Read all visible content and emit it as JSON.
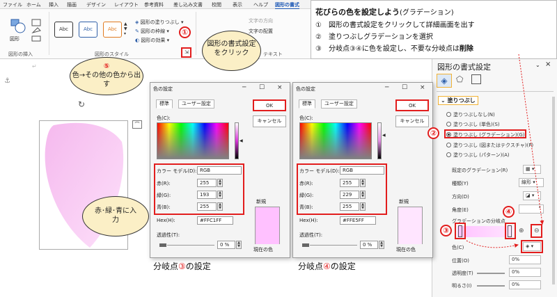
{
  "ribbon": {
    "tabs": [
      "ファイル",
      "ホーム",
      "挿入",
      "描画",
      "デザイン",
      "レイアウト",
      "参考資料",
      "差し込み文書",
      "校閲",
      "表示",
      "ヘルプ",
      "図形の書式"
    ],
    "insert_shapes": "図形の挿入",
    "shapes_btn": "図形",
    "style_sample": "Abc",
    "fill_btn": "図形の塗りつぶし",
    "outline_btn": "図形の枠線",
    "effect_btn": "図形の効果",
    "styles_group": "図形のスタイル",
    "text_dir": "文字の方向",
    "text_align": "文字の配置",
    "text_group": "テキスト",
    "launcher_icon": "⇲"
  },
  "note": {
    "title": "花びらの色を設定しよう",
    "title_sub": "(グラデーション)",
    "step1": "①　図形の書式設定をクリックして詳細画面を出す",
    "step2": "②　塗りつぶしグラデーションを選択",
    "step3_a": "③　分岐点③④に色を設定し、不要な分岐点は",
    "step3_b": "削除"
  },
  "pane": {
    "title": "図形の書式設定",
    "section": "塗りつぶし",
    "options": [
      "塗りつぶしなし(N)",
      "塗りつぶし (単色)(S)",
      "塗りつぶし (グラデーション)(G)",
      "塗りつぶし (図またはテクスチャ)(P)",
      "塗りつぶし (パターン)(A)"
    ],
    "preset": "既定のグラデーション(R)",
    "kind": "種類(Y)",
    "kind_value": "線形",
    "direction": "方向(D)",
    "angle": "角度(E)",
    "angle_value": "°",
    "stops": "グラデーションの分岐点",
    "color": "色(C)",
    "position": "位置(O)",
    "position_value": "0%",
    "transparency": "透明度(T)",
    "transparency_value": "0%",
    "brightness": "明るさ(I)",
    "brightness_value": "0%"
  },
  "dialog1": {
    "title": "色の設定",
    "tab_std": "標準",
    "tab_user": "ユーザー設定",
    "ok": "OK",
    "cancel": "キャンセル",
    "color_label": "色(C):",
    "model_label": "カラー モデル(D):",
    "model_value": "RGB",
    "red_label": "赤(R):",
    "red": "255",
    "green_label": "緑(G):",
    "green": "193",
    "blue_label": "青(B):",
    "blue": "255",
    "hex_label": "Hex(H):",
    "hex": "#FFC1FF",
    "new_label": "新規",
    "current_label": "現在の色",
    "trans_label": "透過性(T):",
    "trans": "0 %",
    "new_color": "#ffc1ff",
    "current_color": "#ffc1ff"
  },
  "dialog2": {
    "title": "色の設定",
    "tab_std": "標準",
    "tab_user": "ユーザー設定",
    "ok": "OK",
    "cancel": "キャンセル",
    "color_label": "色(C):",
    "model_label": "カラー モデル(D):",
    "model_value": "RGB",
    "red_label": "赤(R):",
    "red": "255",
    "green_label": "緑(G):",
    "green": "229",
    "blue_label": "青(B):",
    "blue": "255",
    "hex_label": "Hex(H):",
    "hex": "#FFE5FF",
    "new_label": "新規",
    "current_label": "現在の色",
    "trans_label": "透過性(T):",
    "trans": "0 %",
    "new_color": "#ffe5ff",
    "current_color": "#ffe5ff"
  },
  "callouts": {
    "c1_num": "①",
    "c1_text": "図形の書式設定をクリック",
    "c2_num": "②",
    "c3_num": "③",
    "c4_num": "④",
    "c5_num": "⑤",
    "c5_text": "色→その他の色から出す",
    "rgb_text": "赤･緑･青に入力"
  },
  "captions": {
    "cap1_a": "分岐点",
    "cap1_num": "③",
    "cap1_b": "の設定",
    "cap2_a": "分岐点",
    "cap2_num": "④",
    "cap2_b": "の設定"
  },
  "window": {
    "close": "×",
    "minimize": "─",
    "restore": "☐"
  },
  "colors": {
    "accent": "#1a56b5",
    "red": "#e21d1d",
    "petal": "#f6c6f0",
    "bubble": "#fbefc6"
  }
}
